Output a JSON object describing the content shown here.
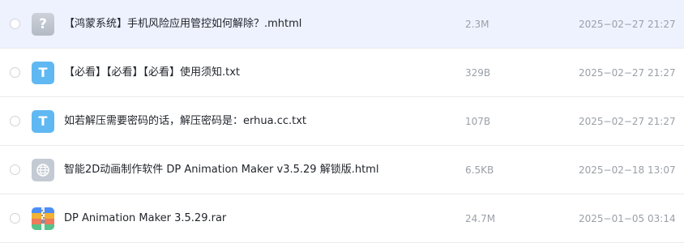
{
  "colors": {
    "selected_row_bg": "#eef2fe",
    "txt_icon": "#5fb8f2",
    "unknown_icon": "#b4bac4",
    "html_icon": "#c4cad3",
    "meta_text": "#9aa0a8",
    "name_text": "#1f2329"
  },
  "files": [
    {
      "name": "【鸿蒙系统】手机风险应用管控如何解除？.mhtml",
      "size": "2.3M",
      "date": "2025−02−27 21:27",
      "icon": "question-file-icon",
      "selected": true
    },
    {
      "name": "【必看】【必看】【必看】使用须知.txt",
      "size": "329B",
      "date": "2025−02−27 21:27",
      "icon": "txt-file-icon",
      "selected": false
    },
    {
      "name": "如若解压需要密码的话，解压密码是：erhua.cc.txt",
      "size": "107B",
      "date": "2025−02−27 21:27",
      "icon": "txt-file-icon",
      "selected": false
    },
    {
      "name": "智能2D动画制作软件 DP Animation Maker v3.5.29 解锁版.html",
      "size": "6.5KB",
      "date": "2025−02−18 13:07",
      "icon": "globe-file-icon",
      "selected": false
    },
    {
      "name": "DP Animation Maker 3.5.29.rar",
      "size": "24.7M",
      "date": "2025−01−05 03:14",
      "icon": "archive-file-icon",
      "selected": false
    }
  ],
  "icon_glyphs": {
    "unknown": "?",
    "txt": "T"
  }
}
